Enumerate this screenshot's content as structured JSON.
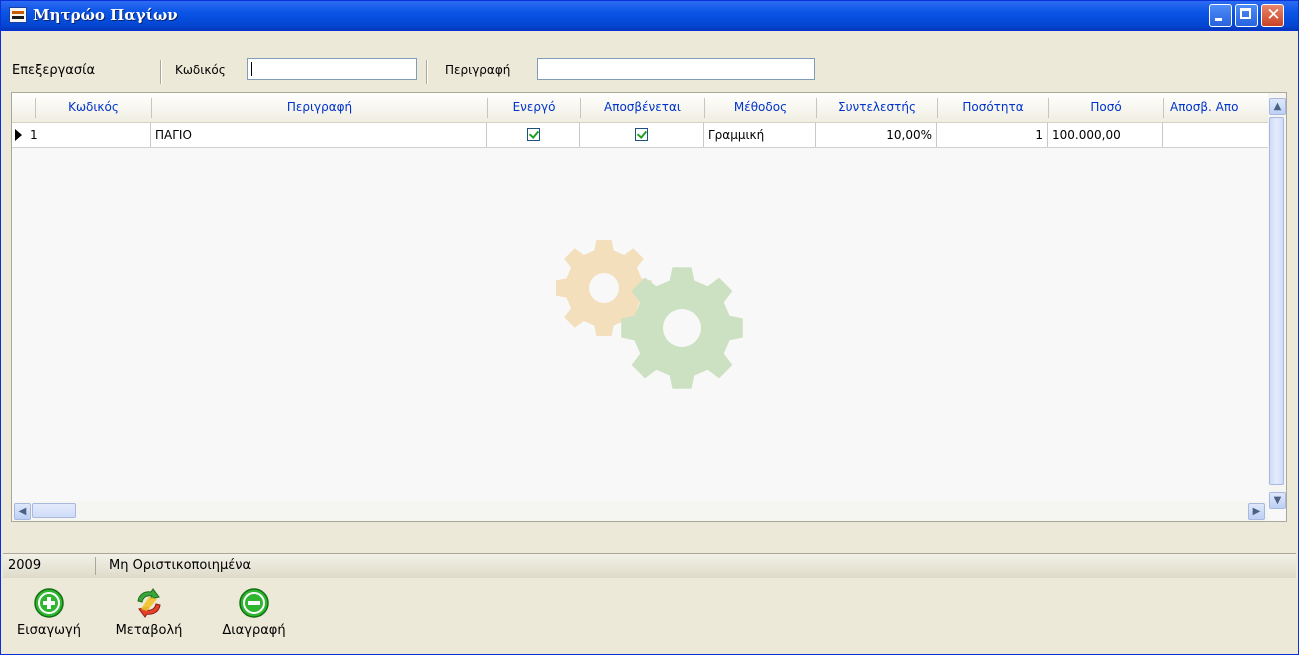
{
  "window": {
    "title": "Μητρώο Παγίων",
    "controls": [
      "minimize",
      "maximize",
      "close"
    ]
  },
  "toolbar": {
    "menu_label": "Επεξεργασία",
    "code_label": "Κωδικός",
    "code_value": "",
    "description_label": "Περιγραφή",
    "description_value": ""
  },
  "grid": {
    "columns": [
      "Κωδικός",
      "Περιγραφή",
      "Ενεργό",
      "Αποσβένεται",
      "Μέθοδος",
      "Συντελεστής",
      "Ποσότητα",
      "Ποσό",
      "Αποσβ. Απο"
    ],
    "rows": [
      {
        "code": "1",
        "description": "ΠΑΓΙΟ",
        "active": true,
        "depreciable": true,
        "method": "Γραμμική",
        "rate": "10,00%",
        "quantity": "1",
        "amount": "100.000,00",
        "depreciation_from": ""
      }
    ]
  },
  "status": {
    "year": "2009",
    "state": "Μη Οριστικοποιημένα"
  },
  "actions": [
    {
      "label": "Εισαγωγή",
      "icon": "plus-circle-icon",
      "color": "#2fb52f"
    },
    {
      "label": "Μεταβολή",
      "icon": "refresh-arrows-icon",
      "color": "#e05020"
    },
    {
      "label": "Διαγραφή",
      "icon": "minus-circle-icon",
      "color": "#2fb52f"
    }
  ],
  "colors": {
    "titlebar": "#0a54e6",
    "header_text": "#0033cc",
    "window_bg": "#ece9d8"
  }
}
